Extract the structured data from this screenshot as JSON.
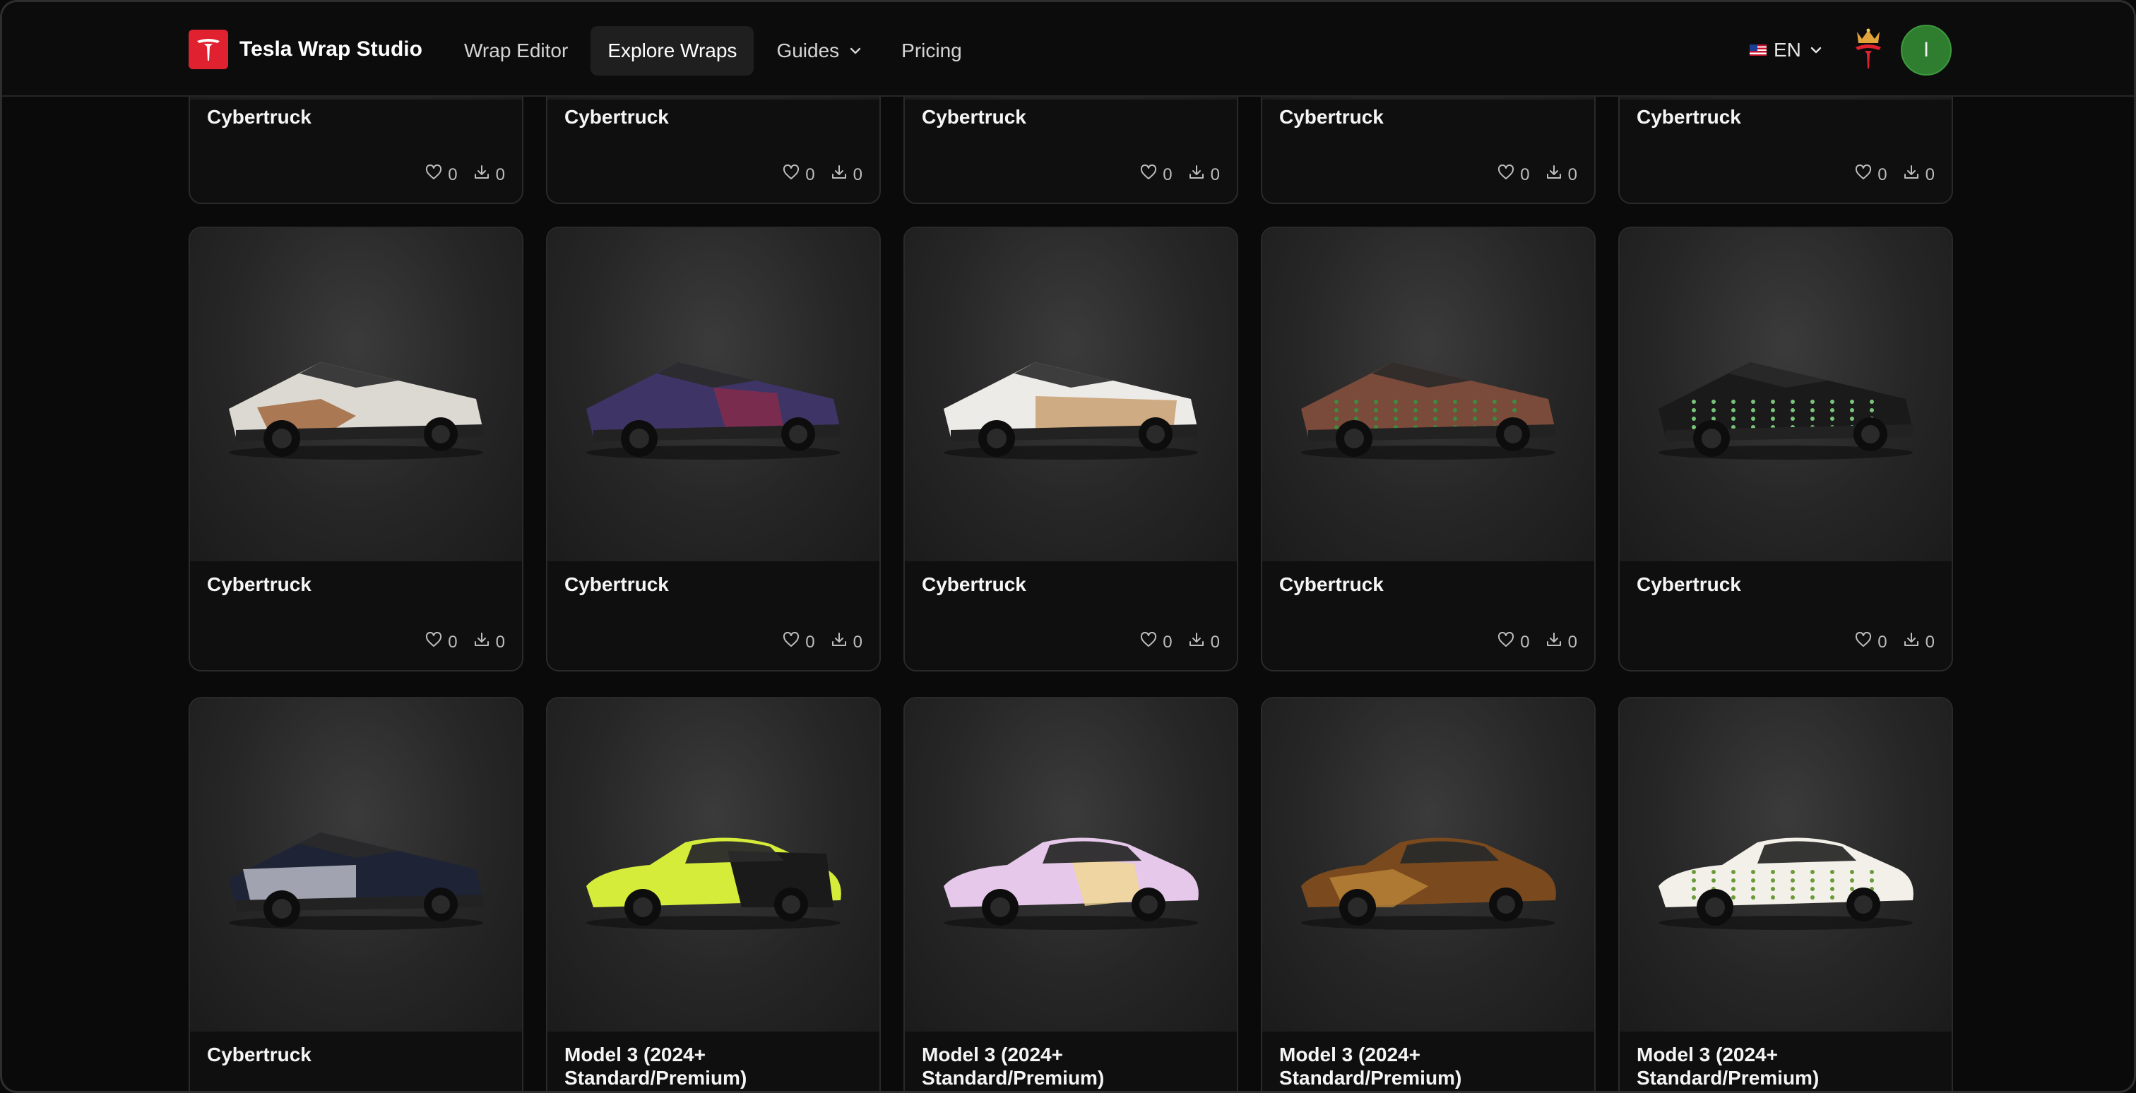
{
  "header": {
    "brand_name": "Tesla Wrap Studio",
    "nav": [
      {
        "label": "Wrap Editor",
        "active": false
      },
      {
        "label": "Explore Wraps",
        "active": true
      },
      {
        "label": "Guides",
        "active": false,
        "has_dropdown": true
      },
      {
        "label": "Pricing",
        "active": false
      }
    ],
    "language": "EN",
    "avatar_initial": "I"
  },
  "colors": {
    "brand_red": "#e0212f",
    "avatar_green": "#2f7d2f",
    "background": "#0a0a0a"
  },
  "cards": [
    {
      "title": "Cybertruck",
      "likes": "0",
      "downloads": "0",
      "vehicle": "cybertruck",
      "body": "#c8c8c8",
      "accent": "#8a8a8a",
      "pattern": "plain"
    },
    {
      "title": "Cybertruck",
      "likes": "0",
      "downloads": "0",
      "vehicle": "cybertruck",
      "body": "#c8c8c8",
      "accent": "#8a8a8a",
      "pattern": "plain"
    },
    {
      "title": "Cybertruck",
      "likes": "0",
      "downloads": "0",
      "vehicle": "cybertruck",
      "body": "#c8c8c8",
      "accent": "#8a8a8a",
      "pattern": "plain"
    },
    {
      "title": "Cybertruck",
      "likes": "0",
      "downloads": "0",
      "vehicle": "cybertruck",
      "body": "#c8c8c8",
      "accent": "#8a8a8a",
      "pattern": "plain"
    },
    {
      "title": "Cybertruck",
      "likes": "0",
      "downloads": "0",
      "vehicle": "cybertruck",
      "body": "#c8c8c8",
      "accent": "#8a8a8a",
      "pattern": "plain"
    },
    {
      "title": "Cybertruck",
      "likes": "0",
      "downloads": "0",
      "vehicle": "cybertruck",
      "body": "#dcd8d2",
      "accent": "#9a5a2a",
      "pattern": "rust"
    },
    {
      "title": "Cybertruck",
      "likes": "0",
      "downloads": "0",
      "vehicle": "cybertruck",
      "body": "#3e3566",
      "accent": "#8a2a4a",
      "pattern": "anime"
    },
    {
      "title": "Cybertruck",
      "likes": "0",
      "downloads": "0",
      "vehicle": "cybertruck",
      "body": "#ecebe8",
      "accent": "#c9a070",
      "pattern": "wood"
    },
    {
      "title": "Cybertruck",
      "likes": "0",
      "downloads": "0",
      "vehicle": "cybertruck",
      "body": "#7a4a3a",
      "accent": "#3f8a3f",
      "pattern": "dots"
    },
    {
      "title": "Cybertruck",
      "likes": "0",
      "downloads": "0",
      "vehicle": "cybertruck",
      "body": "#1a1a1a",
      "accent": "#7ac47a",
      "pattern": "dots"
    },
    {
      "title": "Cybertruck",
      "likes": "",
      "downloads": "",
      "vehicle": "cybertruck",
      "body": "#1e2436",
      "accent": "#d8dbe4",
      "pattern": "chrome"
    },
    {
      "title": "Model 3 (2024+ Standard/Premium)",
      "likes": "",
      "downloads": "",
      "vehicle": "model3",
      "body": "#d6ec3a",
      "accent": "#1a1a1a",
      "pattern": "split"
    },
    {
      "title": "Model 3 (2024+ Standard/Premium)",
      "likes": "",
      "downloads": "",
      "vehicle": "model3",
      "body": "#e6c8ea",
      "accent": "#f0d890",
      "pattern": "anime"
    },
    {
      "title": "Model 3 (2024+ Standard/Premium)",
      "likes": "",
      "downloads": "",
      "vehicle": "model3",
      "body": "#7a4a1e",
      "accent": "#c08a3a",
      "pattern": "rust"
    },
    {
      "title": "Model 3 (2024+ Standard/Premium)",
      "likes": "",
      "downloads": "",
      "vehicle": "model3",
      "body": "#f2f0e8",
      "accent": "#6a9a3a",
      "pattern": "dots"
    }
  ]
}
